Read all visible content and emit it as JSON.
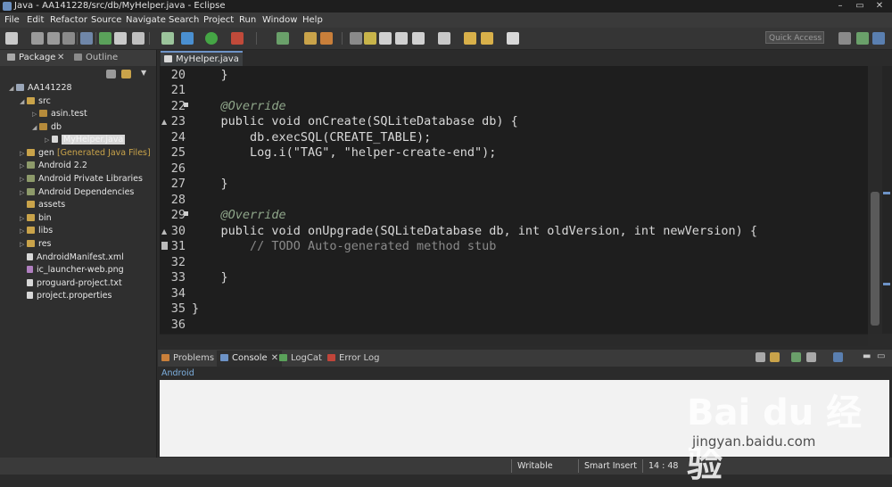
{
  "window": {
    "title": "Java - AA141228/src/db/MyHelper.java - Eclipse",
    "controls": [
      "–",
      "▭",
      "✕"
    ]
  },
  "menu": [
    "File",
    "Edit",
    "Refactor",
    "Source",
    "Navigate",
    "Search",
    "Project",
    "Run",
    "Window",
    "Help"
  ],
  "toolbar": {
    "quick_access_placeholder": "Quick Access"
  },
  "left_panel": {
    "tabs": [
      {
        "label": "Package",
        "close": "✕"
      },
      {
        "label": "Outline",
        "close": ""
      }
    ],
    "tree": [
      {
        "label": "AA141228",
        "icon": "project-icon",
        "indent": 0
      },
      {
        "label": "src",
        "icon": "folder-icon",
        "indent": 1
      },
      {
        "label": "asin.test",
        "icon": "package-icon",
        "indent": 2
      },
      {
        "label": "db",
        "icon": "package-icon",
        "indent": 2
      },
      {
        "label": "MyHelper.java",
        "icon": "java-file-icon",
        "indent": 3,
        "selected": true
      },
      {
        "label": "gen",
        "suffix": "[Generated Java Files]",
        "icon": "folder-icon",
        "indent": 1
      },
      {
        "label": "Android 2.2",
        "icon": "library-icon",
        "indent": 1
      },
      {
        "label": "Android Private Libraries",
        "icon": "library-icon",
        "indent": 1
      },
      {
        "label": "Android Dependencies",
        "icon": "library-icon",
        "indent": 1
      },
      {
        "label": "assets",
        "icon": "folder-icon",
        "indent": 1
      },
      {
        "label": "bin",
        "icon": "folder-icon",
        "indent": 1
      },
      {
        "label": "libs",
        "icon": "folder-icon",
        "indent": 1
      },
      {
        "label": "res",
        "icon": "folder-icon",
        "indent": 1
      },
      {
        "label": "AndroidManifest.xml",
        "icon": "xml-file-icon",
        "indent": 1
      },
      {
        "label": "ic_launcher-web.png",
        "icon": "image-file-icon",
        "indent": 1
      },
      {
        "label": "proguard-project.txt",
        "icon": "text-file-icon",
        "indent": 1
      },
      {
        "label": "project.properties",
        "icon": "text-file-icon",
        "indent": 1
      }
    ]
  },
  "editor": {
    "tab_label": "MyHelper.java",
    "tab_close": "✕",
    "lines": [
      {
        "n": "20",
        "text": "    }"
      },
      {
        "n": "21",
        "text": ""
      },
      {
        "n": "22",
        "text": "    @Override"
      },
      {
        "n": "23",
        "text": "    public void onCreate(SQLiteDatabase db) {"
      },
      {
        "n": "24",
        "text": "        db.execSQL(CREATE_TABLE);"
      },
      {
        "n": "25",
        "text": "        Log.i(\"TAG\", \"helper-create-end\");"
      },
      {
        "n": "26",
        "text": ""
      },
      {
        "n": "27",
        "text": "    }"
      },
      {
        "n": "28",
        "text": ""
      },
      {
        "n": "29",
        "text": "    @Override"
      },
      {
        "n": "30",
        "text": "    public void onUpgrade(SQLiteDatabase db, int oldVersion, int newVersion) {"
      },
      {
        "n": "31",
        "text": "        // TODO Auto-generated method stub"
      },
      {
        "n": "32",
        "text": ""
      },
      {
        "n": "33",
        "text": "    }"
      },
      {
        "n": "34",
        "text": ""
      },
      {
        "n": "35",
        "text": "}"
      },
      {
        "n": "36",
        "text": ""
      }
    ]
  },
  "bottom_panel": {
    "tabs": [
      "Problems",
      "Console",
      "LogCat",
      "Error Log"
    ],
    "active_tab": "Console",
    "console_name": "Android"
  },
  "status_bar": {
    "mode": "Writable",
    "insert": "Smart Insert",
    "position": "14 : 48"
  },
  "watermark": {
    "text": "Bai du 经验",
    "url": "jingyan.baidu.com"
  }
}
